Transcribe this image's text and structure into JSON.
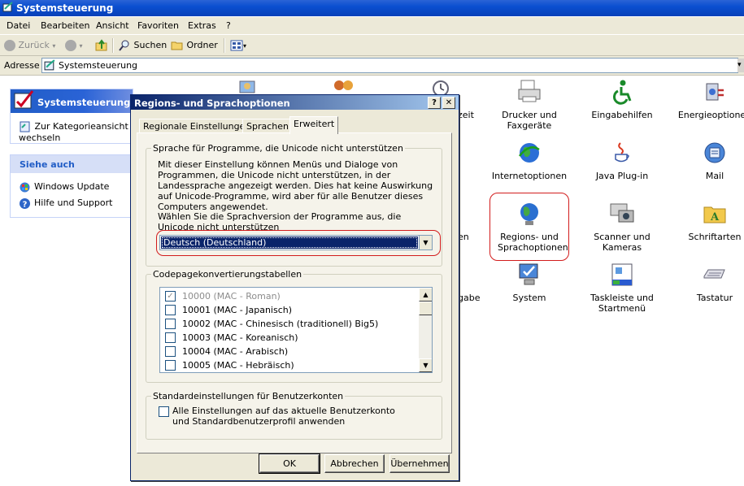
{
  "window": {
    "title": "Systemsteuerung"
  },
  "menu": [
    "Datei",
    "Bearbeiten",
    "Ansicht",
    "Favoriten",
    "Extras",
    "?"
  ],
  "toolbar": {
    "back": "Zurück",
    "search": "Suchen",
    "folders": "Ordner"
  },
  "address": {
    "label": "Adresse",
    "value": "Systemsteuerung"
  },
  "taskpane": {
    "title": "Systemsteuerung",
    "switch_view": "Zur Kategorieansicht wechseln",
    "see_also_title": "Siehe auch",
    "links": [
      "Windows Update",
      "Hilfe und Support"
    ]
  },
  "icons": {
    "zeit": "zeit",
    "drucker": "Drucker und Faxgeräte",
    "eingabehilfen": "Eingabehilfen",
    "energie": "Energieoptionen",
    "internet": "Internetoptionen",
    "java": "Java Plug-in",
    "mail": "Mail",
    "en": "en",
    "regions": "Regions- und Sprachoptionen",
    "scanner": "Scanner und Kameras",
    "schriftarten": "Schriftarten",
    "gabe": "gabe",
    "system": "System",
    "taskleiste": "Taskleiste und Startmenü",
    "tastatur": "Tastatur"
  },
  "dialog": {
    "title": "Regions- und Sprachoptionen",
    "help_btn": "?",
    "close_btn": "✕",
    "tabs": [
      "Regionale Einstellungen",
      "Sprachen",
      "Erweitert"
    ],
    "group1": {
      "legend": "Sprache für Programme, die Unicode nicht unterstützen",
      "desc": "Mit dieser Einstellung können Menüs und Dialoge von Programmen, die Unicode nicht unterstützen, in der Landessprache angezeigt werden. Dies hat keine Auswirkung auf Unicode-Programme, wird aber für alle Benutzer dieses Computers angewendet.",
      "prompt": "Wählen Sie die Sprachversion der Programme aus, die Unicode nicht unterstützen",
      "selected": "Deutsch (Deutschland)"
    },
    "group2": {
      "legend": "Codepagekonvertierungstabellen",
      "rows": [
        {
          "label": "10000 (MAC - Roman)",
          "checked": true,
          "disabled": true
        },
        {
          "label": "10001 (MAC - Japanisch)",
          "checked": false
        },
        {
          "label": "10002 (MAC - Chinesisch (traditionell) Big5)",
          "checked": false
        },
        {
          "label": "10003 (MAC - Koreanisch)",
          "checked": false
        },
        {
          "label": "10004 (MAC - Arabisch)",
          "checked": false
        },
        {
          "label": "10005 (MAC - Hebräisch)",
          "checked": false
        }
      ]
    },
    "group3": {
      "legend": "Standardeinstellungen für Benutzerkonten",
      "checkbox": "Alle Einstellungen auf das aktuelle Benutzerkonto und Standardbenutzerprofil anwenden"
    },
    "buttons": {
      "ok": "OK",
      "cancel": "Abbrechen",
      "apply": "Übernehmen"
    }
  },
  "colors": {
    "highlight_ring": "#d21c1c",
    "xp_blue": "#0a4fd0",
    "dialog_face": "#ece9d8"
  }
}
